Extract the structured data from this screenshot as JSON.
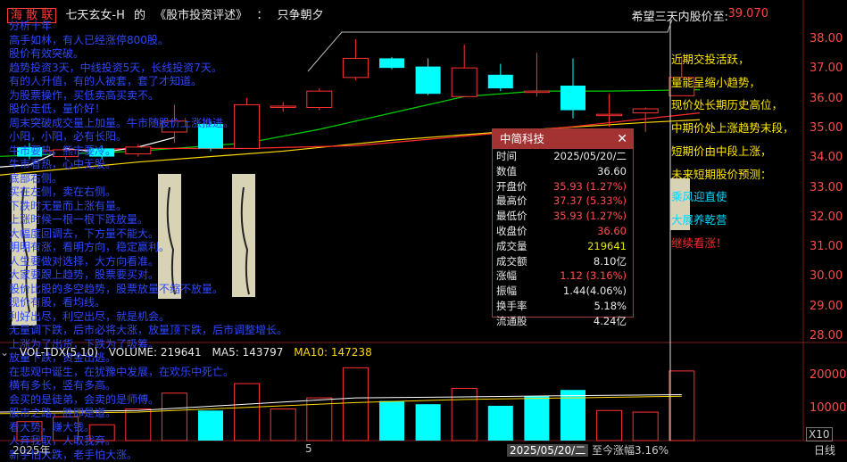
{
  "header": {
    "name": "海 散 联",
    "formula_name": "七天玄女-H",
    "of": "的",
    "book": "《股市投资评述》",
    "colon": "：",
    "slogan": "只争朝夕",
    "hope_label": "希望三天内股价至:",
    "hope_value": "39.070"
  },
  "price_axis": [
    "38.00",
    "37.00",
    "36.00",
    "35.00",
    "34.00",
    "33.00",
    "32.00",
    "31.00",
    "30.00",
    "29.00",
    "28.00"
  ],
  "left_notes": [
    "分析十年",
    "高手如林，有人已经涨停800股。",
    "股价有效突破。",
    "趋势投资3天，中线投资5天，长线投资7天。",
    "有的人升值，有的人被套，套了才知道。",
    "为股票操作，买低卖高买卖不。",
    "股价走低，量价好！",
    "周末突破成交量上加量。牛市随股价上涨推进。",
    "小阳，小阳，必有长阳。",
    "牛市要热，熊市要冷。",
    "牛市看热，心中无股。",
    "底部右侧。",
    "买在左侧，卖在右侧。",
    "下跌时无量而上涨有量。",
    "上涨时候一根一根下跌放量。",
    "大幅度回调去，下方量不能大。",
    "明明有涨，看明方向，稳定赢利。",
    "人生要做对选择，大方向看准。",
    "大家要跟上趋势，股票要买对。",
    "股价比股的多空趋势，股票放量不缩不放量。",
    "现价有股，看均线。",
    "利好出尽，利空出尽，就是机会。",
    "无量调下跌，后市必将大涨，放量顶下跌，后市调整增长。",
    "上涨为了出货，下跌为了吸筹。",
    "放量下跌，资金出逃。",
    "在悲观中诞生，在犹豫中发展，在欢乐中死亡。",
    "横有多长，竖有多高。",
    "会买的是徒弟，会卖的是师傅。",
    "股市之路，胜即是道。",
    "看大势，赚大钱。",
    "人弃我取，人取我弃。",
    "新手怕大跌，老手怕大涨。"
  ],
  "right_notes": [
    "近期交投活跃，",
    "量能呈缩小趋势，",
    "现价处长期历史高位，",
    "中期价处上涨趋势末段，",
    "短期价由中段上涨，",
    "未来短期股价预测：",
    "乘风迎直使",
    "大展养乾营",
    "继续看涨！"
  ],
  "popup": {
    "title": "中简科技",
    "rows": [
      {
        "label": "时间",
        "value": "2025/05/20/二",
        "color": "white"
      },
      {
        "label": "数值",
        "value": "36.60",
        "color": "white"
      },
      {
        "label": "开盘价",
        "value": "35.93 (1.27%)",
        "color": "red"
      },
      {
        "label": "最高价",
        "value": "37.37 (5.33%)",
        "color": "red"
      },
      {
        "label": "最低价",
        "value": "35.93 (1.27%)",
        "color": "red"
      },
      {
        "label": "收盘价",
        "value": "36.60",
        "color": "red"
      },
      {
        "label": "成交量",
        "value": "219641",
        "color": "yellow"
      },
      {
        "label": "成交额",
        "value": "8.10亿",
        "color": "white"
      },
      {
        "label": "涨幅",
        "value": "1.12 (3.16%)",
        "color": "red"
      },
      {
        "label": "振幅",
        "value": "1.44(4.06%)",
        "color": "white"
      },
      {
        "label": "换手率",
        "value": "5.18%",
        "color": "white"
      },
      {
        "label": "流通股",
        "value": "4.24亿",
        "color": "white"
      }
    ]
  },
  "volume": {
    "indicator": "VOL-TDX(5,10)",
    "volume_label": "VOLUME: 219641",
    "ma5_label": "MA5: 143797",
    "ma10_label": "MA10: 147238",
    "axis": [
      "20000",
      "10000"
    ],
    "x10": "X10"
  },
  "bottom": {
    "year": "2025年",
    "month_mark": "5",
    "current_date": "2025/05/20/二",
    "change_text": "至今涨幅3.16%",
    "period": "日线"
  },
  "colors": {
    "up": "#ff3232",
    "down": "#00ffff",
    "ma_white": "#ffffff",
    "ma_yellow": "#ffd800",
    "ma_green": "#00d000",
    "ma_red": "#ff2a2a"
  },
  "candles": [
    {
      "o": 34.05,
      "c": 33.7,
      "h": 34.2,
      "l": 33.6
    },
    {
      "o": 33.7,
      "c": 33.95,
      "h": 34.05,
      "l": 33.6
    },
    {
      "o": 34.0,
      "c": 33.7,
      "h": 34.1,
      "l": 33.6
    },
    {
      "o": 33.8,
      "c": 34.05,
      "h": 34.15,
      "l": 33.7
    },
    {
      "o": 34.6,
      "c": 35.0,
      "h": 35.6,
      "l": 34.2
    },
    {
      "o": 34.9,
      "c": 34.0,
      "h": 35.0,
      "l": 33.9
    },
    {
      "o": 34.0,
      "c": 35.6,
      "h": 35.85,
      "l": 34.0
    },
    {
      "o": 35.5,
      "c": 35.55,
      "h": 35.7,
      "l": 35.35
    },
    {
      "o": 35.5,
      "c": 36.1,
      "h": 36.2,
      "l": 35.4
    },
    {
      "o": 36.6,
      "c": 37.3,
      "h": 38.0,
      "l": 36.5
    },
    {
      "o": 37.3,
      "c": 36.95,
      "h": 37.35,
      "l": 36.9
    },
    {
      "o": 37.0,
      "c": 36.0,
      "h": 37.3,
      "l": 35.95
    },
    {
      "o": 35.9,
      "c": 36.95,
      "h": 37.8,
      "l": 35.9
    },
    {
      "o": 36.7,
      "c": 36.2,
      "h": 37.1,
      "l": 36.1
    },
    {
      "o": 36.05,
      "c": 36.1,
      "h": 37.5,
      "l": 35.9
    },
    {
      "o": 36.3,
      "c": 35.4,
      "h": 37.3,
      "l": 35.1
    },
    {
      "o": 35.25,
      "c": 35.25,
      "h": 36.0,
      "l": 34.8
    },
    {
      "o": 35.3,
      "c": 35.45,
      "h": 35.5,
      "l": 34.6
    },
    {
      "o": 35.93,
      "c": 36.6,
      "h": 37.37,
      "l": 35.93
    }
  ],
  "volumes": [
    {
      "v": 6000,
      "up": true
    },
    {
      "v": 7500,
      "up": true
    },
    {
      "v": 5000,
      "up": true
    },
    {
      "v": 10000,
      "up": true
    },
    {
      "v": 15000,
      "up": true
    },
    {
      "v": 9500,
      "up": false
    },
    {
      "v": 18000,
      "up": true
    },
    {
      "v": 10000,
      "up": true
    },
    {
      "v": 13500,
      "up": true
    },
    {
      "v": 23000,
      "up": true
    },
    {
      "v": 12500,
      "up": false
    },
    {
      "v": 11500,
      "up": false
    },
    {
      "v": 16500,
      "up": true
    },
    {
      "v": 11000,
      "up": false
    },
    {
      "v": 14000,
      "up": false
    },
    {
      "v": 16000,
      "up": false
    },
    {
      "v": 9500,
      "up": true
    },
    {
      "v": 9000,
      "up": true
    },
    {
      "v": 22000,
      "up": true
    }
  ]
}
